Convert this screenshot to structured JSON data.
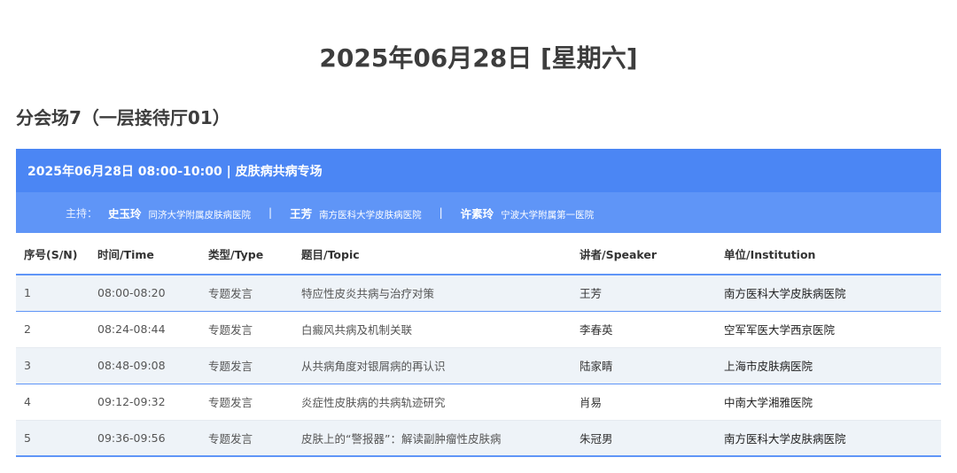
{
  "page": {
    "date_title": "2025年06月28日 [星期六]",
    "venue": "分会场7（一层接待厅01）"
  },
  "session": {
    "header": "2025年06月28日 08:00-10:00 | 皮肤病共病专场",
    "chair_label": "主持：",
    "separator": "|",
    "chairs": [
      {
        "name": "史玉玲",
        "institution": "同济大学附属皮肤病医院"
      },
      {
        "name": "王芳",
        "institution": "南方医科大学皮肤病医院"
      },
      {
        "name": "许素玲",
        "institution": "宁波大学附属第一医院"
      }
    ]
  },
  "table": {
    "headers": [
      "序号(S/N)",
      "时间/Time",
      "类型/Type",
      "题目/Topic",
      "讲者/Speaker",
      "单位/Institution"
    ],
    "rows": [
      [
        "1",
        "08:00-08:20",
        "专题发言",
        "特应性皮炎共病与治疗对策",
        "王芳",
        "南方医科大学皮肤病医院"
      ],
      [
        "2",
        "08:24-08:44",
        "专题发言",
        "白癜风共病及机制关联",
        "李春英",
        "空军军医大学西京医院"
      ],
      [
        "3",
        "08:48-09:08",
        "专题发言",
        "从共病角度对银屑病的再认识",
        "陆家睛",
        "上海市皮肤病医院"
      ],
      [
        "4",
        "09:12-09:32",
        "专题发言",
        "炎症性皮肤病的共病轨迹研究",
        "肖易",
        "中南大学湘雅医院"
      ],
      [
        "5",
        "09:36-09:56",
        "专题发言",
        "皮肤上的“警报器”：解读副肿瘤性皮肤病",
        "朱冠男",
        "南方医科大学皮肤病医院"
      ]
    ]
  },
  "colors": {
    "header_blue": "#4b86f4",
    "chair_blue": "#5f95f7",
    "row_stripe": "#eef3f8"
  }
}
